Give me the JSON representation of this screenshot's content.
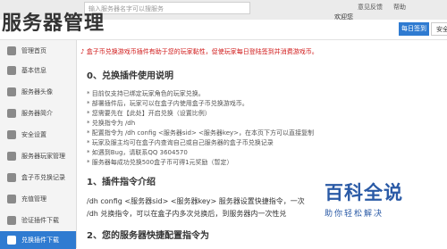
{
  "header": {
    "brand": "服务器管理",
    "search_placeholder": "输入服务器名字可以搜服务",
    "welcome": "欢迎您",
    "link_feedback": "意见反馈",
    "link_help": "帮助",
    "checkin_button": "每日签到",
    "logout_button": "安全退出"
  },
  "sidebar": {
    "items": [
      {
        "label": "管理首页"
      },
      {
        "label": "基本信息"
      },
      {
        "label": "服务器头像"
      },
      {
        "label": "服务器简介"
      },
      {
        "label": "安全设置"
      },
      {
        "label": "服务器玩家管理"
      },
      {
        "label": "盒子币兑换记录"
      },
      {
        "label": "充值管理"
      },
      {
        "label": "验证插件下载"
      },
      {
        "label": "兑换插件下载"
      }
    ],
    "active_index": 9
  },
  "main": {
    "notice": "♪ 盒子币兑换游戏币插件有助于您的玩家黏性，促使玩家每日登陆签到并消费游戏币。",
    "section0_title": "0、兑换插件使用说明",
    "lines": [
      "* 目前仅支持已绑定玩家角色的玩家兑换。",
      "* 部署插件后，玩家可以在盒子内使用盒子币兑换游戏币。",
      "* 您需要先在【此处】开启兑换（设置比例）",
      "* 兑换指令为 /dh",
      "* 配置指令为 /dh config <服务器sid> <服务器key>，在本页下方可以直接复制",
      "* 玩家及服主均可在盒子内查询自己或自己服务器的盒子币兑换记录",
      "* 如遇到Bug，请联系QQ 3604570",
      "* 服务器每成功兑换500盒子币可得1元奖励（暂定）"
    ],
    "section1_title": "1、插件指令介绍",
    "cmd1": "/dh config <服务器sid> <服务器key> 服务器设置快捷指令，一次",
    "cmd2": "/dh 兑换指令，可以在盒子内多次兑换后，到服务器内一次性兑",
    "section2_title": "2、您的服务器快捷配置指令为"
  },
  "watermark": {
    "main": "百科全说",
    "sub": "助你轻松解决"
  },
  "colors": {
    "accent": "#2f7bd1",
    "notice": "#d01a1a",
    "watermark": "#2a5aa6"
  }
}
